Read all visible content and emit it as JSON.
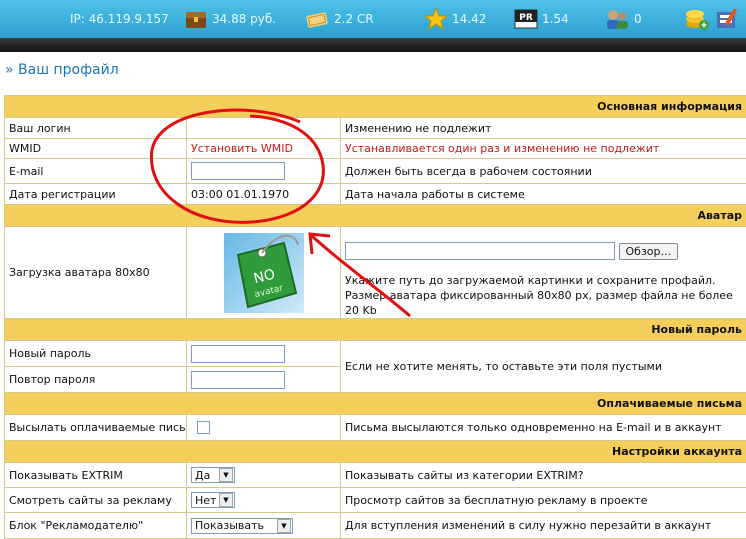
{
  "topbar": {
    "ip": "IP: 46.119.9.157",
    "balance": "34.88 руб.",
    "credits": "2.2 CR",
    "rating": "14.42",
    "pr": "1.54",
    "referrals": "0",
    "pr_badge": "PR"
  },
  "page_title": "» Ваш профайл",
  "sections": {
    "basic": "Основная информация",
    "avatar": "Аватар",
    "password": "Новый пароль",
    "paid_mail": "Оплачиваемые письма",
    "account": "Настройки аккаунта"
  },
  "rows": {
    "login_label": "Ваш логин",
    "login_desc": "Изменению не подлежит",
    "wmid_label": "WMID",
    "wmid_value": "Установить WMID",
    "wmid_desc": "Устанавливается один раз и изменению не подлежит",
    "email_label": "E-mail",
    "email_value": "",
    "email_desc": "Должен быть всегда в рабочем состоянии",
    "regdate_label": "Дата регистрации",
    "regdate_value": "03:00 01.01.1970",
    "regdate_desc": "Дата начала работы в системе",
    "avatar_label": "Загрузка аватара 80x80",
    "avatar_text1": "NO",
    "avatar_text2": "avatar",
    "avatar_file_value": "",
    "browse_button": "Обзор...",
    "avatar_desc": "Укажите путь до загружаемой картинки и сохраните профайл. Размер аватара фиксированный 80x80 px, размер файла не более 20 Kb",
    "newpass_label": "Новый пароль",
    "repeatpass_label": "Повтор пароля",
    "pass_desc": "Если не хотите менять, то оставьте эти поля пустыми",
    "paidmail_label": "Высылать оплачиваемые письма",
    "paidmail_desc": "Письма высылаются только одновременно на E-mail и в аккаунт",
    "extrim_label": "Показывать EXTRIM",
    "extrim_value": "Да",
    "extrim_desc": "Показывать сайты из категории EXTRIM?",
    "adview_label": "Смотреть сайты за рекламу",
    "adview_value": "Нет",
    "adview_desc": "Просмотр сайтов за бесплатную рекламу в проекте",
    "advblock_label": "Блок \"Рекламодателю\"",
    "advblock_value": "Показывать",
    "advblock_desc": "Для вступления изменений в силу нужно перезайти в аккаунт"
  },
  "colors": {
    "topbar": "#3aaedb",
    "section_header": "#f4cf5b",
    "title": "#1b76b8",
    "warning_text": "#c61a1a",
    "annotation": "#e01010"
  }
}
